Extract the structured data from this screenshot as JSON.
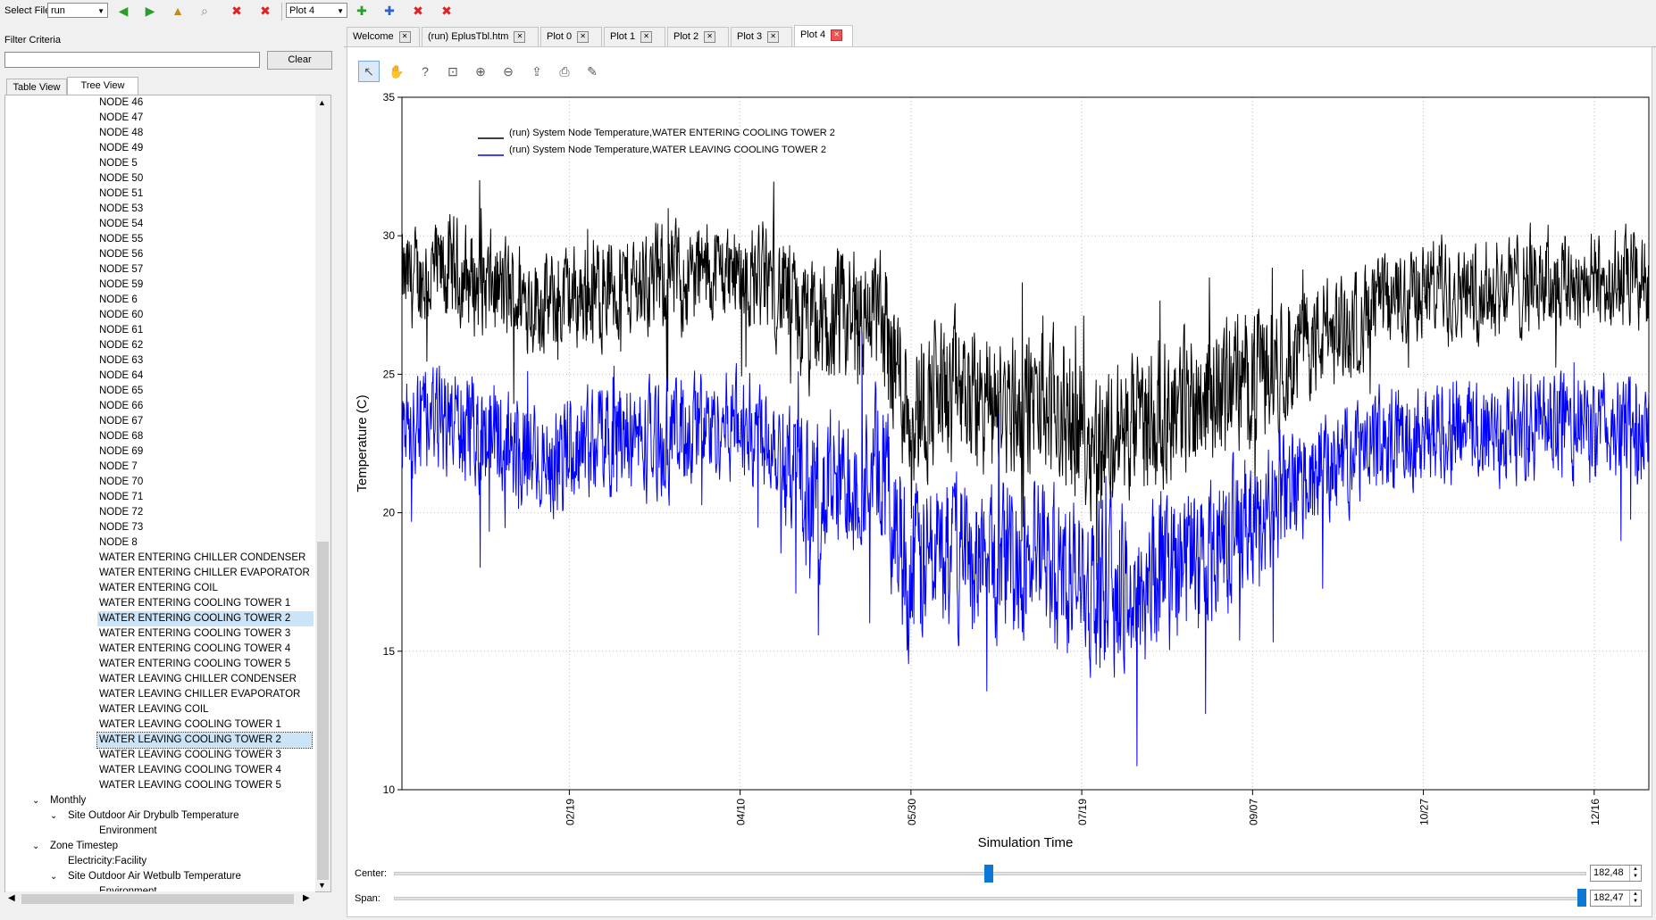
{
  "toolbar": {
    "select_file_label": "Select File",
    "file_value": "run",
    "plot_value": "Plot 4"
  },
  "left": {
    "filter_label": "Filter Criteria",
    "filter_value": "",
    "clear_label": "Clear",
    "tabs": [
      "Table View",
      "Tree View"
    ],
    "tree_items": [
      {
        "label": "NODE 46",
        "level": 4
      },
      {
        "label": "NODE 47",
        "level": 4
      },
      {
        "label": "NODE 48",
        "level": 4
      },
      {
        "label": "NODE 49",
        "level": 4
      },
      {
        "label": "NODE 5",
        "level": 4
      },
      {
        "label": "NODE 50",
        "level": 4
      },
      {
        "label": "NODE 51",
        "level": 4
      },
      {
        "label": "NODE 53",
        "level": 4
      },
      {
        "label": "NODE 54",
        "level": 4
      },
      {
        "label": "NODE 55",
        "level": 4
      },
      {
        "label": "NODE 56",
        "level": 4
      },
      {
        "label": "NODE 57",
        "level": 4
      },
      {
        "label": "NODE 59",
        "level": 4
      },
      {
        "label": "NODE 6",
        "level": 4
      },
      {
        "label": "NODE 60",
        "level": 4
      },
      {
        "label": "NODE 61",
        "level": 4
      },
      {
        "label": "NODE 62",
        "level": 4
      },
      {
        "label": "NODE 63",
        "level": 4
      },
      {
        "label": "NODE 64",
        "level": 4
      },
      {
        "label": "NODE 65",
        "level": 4
      },
      {
        "label": "NODE 66",
        "level": 4
      },
      {
        "label": "NODE 67",
        "level": 4
      },
      {
        "label": "NODE 68",
        "level": 4
      },
      {
        "label": "NODE 69",
        "level": 4
      },
      {
        "label": "NODE 7",
        "level": 4
      },
      {
        "label": "NODE 70",
        "level": 4
      },
      {
        "label": "NODE 71",
        "level": 4
      },
      {
        "label": "NODE 72",
        "level": 4
      },
      {
        "label": "NODE 73",
        "level": 4
      },
      {
        "label": "NODE 8",
        "level": 4
      },
      {
        "label": "WATER ENTERING CHILLER CONDENSER",
        "level": 4
      },
      {
        "label": "WATER ENTERING CHILLER EVAPORATOR",
        "level": 4
      },
      {
        "label": "WATER ENTERING COIL",
        "level": 4
      },
      {
        "label": "WATER ENTERING COOLING TOWER 1",
        "level": 4
      },
      {
        "label": "WATER ENTERING COOLING TOWER 2",
        "level": 4,
        "selected": "primary"
      },
      {
        "label": "WATER ENTERING COOLING TOWER 3",
        "level": 4
      },
      {
        "label": "WATER ENTERING COOLING TOWER 4",
        "level": 4
      },
      {
        "label": "WATER ENTERING COOLING TOWER 5",
        "level": 4
      },
      {
        "label": "WATER LEAVING CHILLER CONDENSER",
        "level": 4
      },
      {
        "label": "WATER LEAVING CHILLER EVAPORATOR",
        "level": 4
      },
      {
        "label": "WATER LEAVING COIL",
        "level": 4
      },
      {
        "label": "WATER LEAVING COOLING TOWER 1",
        "level": 4
      },
      {
        "label": "WATER LEAVING COOLING TOWER 2",
        "level": 4,
        "selected": "focus"
      },
      {
        "label": "WATER LEAVING COOLING TOWER 3",
        "level": 4
      },
      {
        "label": "WATER LEAVING COOLING TOWER 4",
        "level": 4
      },
      {
        "label": "WATER LEAVING COOLING TOWER 5",
        "level": 4
      },
      {
        "label": "Monthly",
        "level": 2,
        "expanded": true
      },
      {
        "label": "Site Outdoor Air Drybulb Temperature",
        "level": 3,
        "expanded": true
      },
      {
        "label": "Environment",
        "level": 4
      },
      {
        "label": "Zone Timestep",
        "level": 2,
        "expanded": true
      },
      {
        "label": "Electricity:Facility",
        "level": 3
      },
      {
        "label": "Site Outdoor Air Wetbulb Temperature",
        "level": 3,
        "expanded": true
      },
      {
        "label": "Environment",
        "level": 4
      }
    ]
  },
  "tabs": [
    {
      "label": "Welcome",
      "active": false
    },
    {
      "label": "(run) EplusTbl.htm",
      "active": false
    },
    {
      "label": "Plot 0",
      "active": false
    },
    {
      "label": "Plot 1",
      "active": false
    },
    {
      "label": "Plot 2",
      "active": false
    },
    {
      "label": "Plot 3",
      "active": false
    },
    {
      "label": "Plot 4",
      "active": true
    }
  ],
  "plot_tools": [
    "pointer-icon",
    "pan-icon",
    "help-icon",
    "zoom-box-icon",
    "zoom-in-icon",
    "zoom-out-icon",
    "export-icon",
    "print-icon",
    "edit-icon"
  ],
  "chart_data": {
    "type": "line",
    "title": "",
    "xlabel": "Simulation Time",
    "ylabel": "Temperature (C)",
    "ylim": [
      10,
      35
    ],
    "yticks": [
      10,
      15,
      20,
      25,
      30,
      35
    ],
    "xlim_day": [
      1,
      366
    ],
    "xticks": [
      {
        "label": "02/19",
        "day": 50
      },
      {
        "label": "04/10",
        "day": 100
      },
      {
        "label": "05/30",
        "day": 150
      },
      {
        "label": "07/19",
        "day": 200
      },
      {
        "label": "09/07",
        "day": 250
      },
      {
        "label": "10/27",
        "day": 300
      },
      {
        "label": "12/16",
        "day": 350
      }
    ],
    "grid": true,
    "legend_position": "top-left",
    "series": [
      {
        "name": "(run) System Node Temperature,WATER ENTERING COOLING TOWER 2",
        "color": "#000000",
        "envelope": {
          "day": [
            1,
            15,
            30,
            45,
            60,
            75,
            85,
            95,
            110,
            120,
            130,
            140,
            150,
            160,
            175,
            185,
            195,
            205,
            215,
            225,
            235,
            245,
            255,
            265,
            280,
            290,
            305,
            320,
            335,
            350,
            366
          ],
          "center": [
            28.3,
            28.7,
            28.0,
            27.5,
            28.1,
            28.4,
            28.5,
            28.8,
            28.3,
            26.5,
            26.8,
            27.3,
            23.8,
            24.5,
            23.8,
            24.0,
            23.5,
            22.6,
            22.9,
            23.8,
            24.3,
            24.8,
            25.3,
            26.1,
            26.8,
            27.6,
            28.3,
            28.1,
            28.5,
            28.3,
            28.4
          ],
          "spread": [
            1.6,
            1.7,
            1.7,
            1.6,
            1.7,
            1.7,
            1.7,
            1.5,
            1.8,
            2.2,
            2.2,
            2.2,
            2.6,
            2.3,
            2.3,
            2.3,
            2.3,
            2.3,
            2.3,
            2.3,
            2.3,
            2.2,
            2.0,
            1.8,
            1.6,
            1.6,
            1.5,
            1.6,
            1.6,
            1.6,
            1.6
          ]
        }
      },
      {
        "name": "(run) System Node Temperature,WATER LEAVING COOLING TOWER 2",
        "color": "#0000ff",
        "envelope": {
          "day": [
            1,
            15,
            30,
            45,
            60,
            75,
            85,
            95,
            110,
            120,
            130,
            140,
            150,
            160,
            175,
            185,
            195,
            205,
            215,
            225,
            235,
            245,
            255,
            265,
            280,
            290,
            305,
            320,
            335,
            350,
            366
          ],
          "center": [
            23.1,
            23.4,
            22.6,
            21.9,
            22.9,
            22.6,
            23.0,
            23.3,
            22.9,
            20.5,
            21.0,
            21.8,
            17.8,
            18.7,
            18.2,
            18.5,
            17.8,
            17.2,
            17.0,
            18.0,
            18.6,
            19.3,
            20.2,
            21.0,
            22.1,
            22.7,
            23.1,
            22.9,
            23.2,
            23.0,
            23.1
          ],
          "spread": [
            1.6,
            1.7,
            1.8,
            1.7,
            1.7,
            1.8,
            1.8,
            1.6,
            1.8,
            2.4,
            2.4,
            2.3,
            2.8,
            2.4,
            2.4,
            2.4,
            2.5,
            2.5,
            2.6,
            2.5,
            2.4,
            2.2,
            2.0,
            1.8,
            1.6,
            1.6,
            1.6,
            1.7,
            1.7,
            1.7,
            1.7
          ]
        }
      }
    ]
  },
  "controls": {
    "center_label": "Center:",
    "center_value": "182,48",
    "center_fraction": 0.499,
    "span_label": "Span:",
    "span_value": "182,47",
    "span_fraction": 1.0
  }
}
